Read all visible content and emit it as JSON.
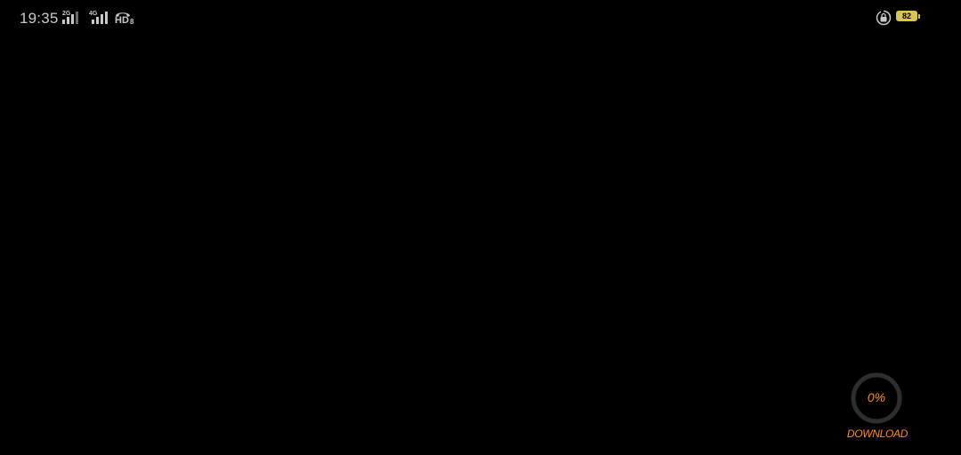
{
  "status_bar": {
    "time": "19:35",
    "signal_1": {
      "tag": "2G",
      "icon": "signal-bars-icon"
    },
    "signal_2": {
      "tag": "4G",
      "icon": "signal-bars-icon"
    },
    "volte": {
      "label": "HD",
      "sub": "8",
      "icon": "hd-call-icon"
    },
    "rotation_lock_icon": "rotation-lock-icon",
    "battery": {
      "level": "82",
      "color": "#d8c45a"
    }
  },
  "download": {
    "percent": "0%",
    "label": "DOWNLOAD",
    "progress": 0,
    "accent_color": "#ff8c1a"
  }
}
